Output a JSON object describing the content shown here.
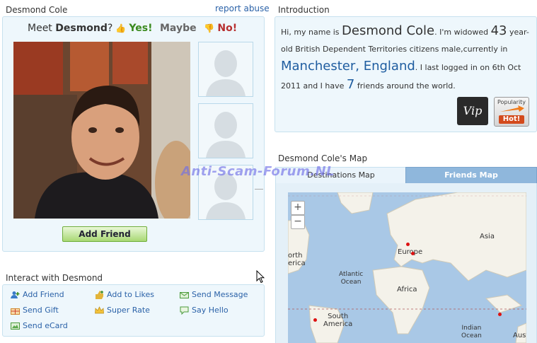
{
  "profile": {
    "name": "Desmond Cole",
    "report_link": "report abuse",
    "meet_prefix": "Meet",
    "meet_name": "Desmond",
    "meet_suffix": "?",
    "vote_yes": "Yes!",
    "vote_maybe": "Maybe",
    "vote_no": "No!",
    "add_friend_button": "Add Friend"
  },
  "interact": {
    "title": "Interact with Desmond",
    "actions": [
      {
        "label": "Add Friend",
        "icon": "add-friend-icon"
      },
      {
        "label": "Add to Likes",
        "icon": "like-icon"
      },
      {
        "label": "Send Message",
        "icon": "envelope-icon"
      },
      {
        "label": "Send Gift",
        "icon": "gift-icon"
      },
      {
        "label": "Super Rate",
        "icon": "crown-icon"
      },
      {
        "label": "Say Hello",
        "icon": "speech-icon"
      },
      {
        "label": "Send eCard",
        "icon": "ecard-icon"
      }
    ]
  },
  "intro": {
    "title": "Introduction",
    "t1": "Hi, my name is",
    "name": "Desmond Cole",
    "t2": ". I'm widowed",
    "age": "43",
    "t3": "year-old British Dependent Territories citizens male,currently in",
    "city": "Manchester, England",
    "t4": ". I last logged in on 6th Oct 2011 and I have",
    "friends": "7",
    "t5": "friends around the world.",
    "vip_badge": "Vip",
    "popularity_label": "Popularity",
    "popularity_value": "Hot!"
  },
  "map": {
    "title": "Desmond Cole's Map",
    "tab_destinations": "Destinations Map",
    "tab_friends": "Friends Map",
    "zoom_in": "+",
    "zoom_out": "−",
    "labels": {
      "asia": "Asia",
      "europe": "Europe",
      "north_america": "orth\nerica",
      "atlantic": "Atlantic\nOcean",
      "africa": "Africa",
      "south_america": "South\nAmerica",
      "indian": "Indian\nOcean",
      "australia": "Aust"
    }
  },
  "watermark": "Anti-Scam-Forum.NL",
  "colors": {
    "panel_bg": "#eef7fc",
    "link": "#2b62a8",
    "city": "#1f5da0",
    "yes": "#3a8a1e",
    "no": "#b72f2f"
  }
}
